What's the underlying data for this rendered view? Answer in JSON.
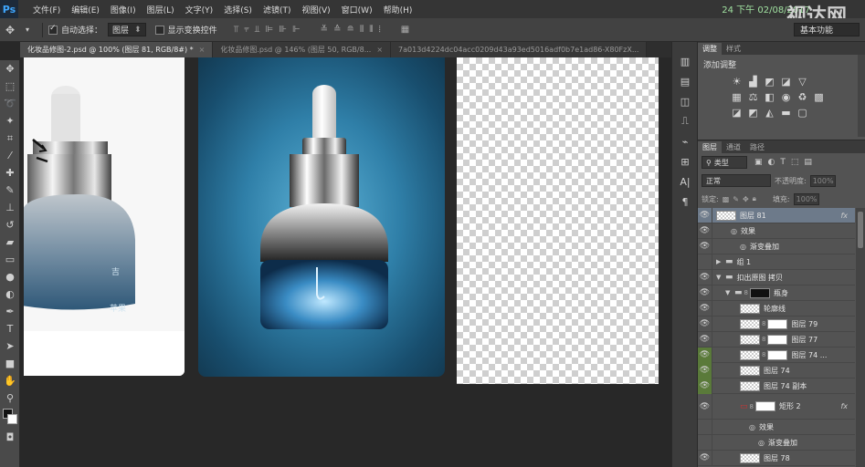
{
  "app": {
    "logo": "Ps",
    "menu": [
      "文件(F)",
      "编辑(E)",
      "图像(I)",
      "图层(L)",
      "文字(Y)",
      "选择(S)",
      "滤镜(T)",
      "视图(V)",
      "窗口(W)",
      "帮助(H)"
    ],
    "watermark_time": "24 下午 02/08/2017",
    "watermark_logo": "视达网"
  },
  "options": {
    "auto_select_label": "自动选择：",
    "auto_select_value": "图层",
    "show_transform_label": "显示变换控件",
    "workspace": "基本功能"
  },
  "tabs": [
    {
      "label": "化妆品修图-2.psd @ 100% (图层 81, RGB/8#) *",
      "active": true
    },
    {
      "label": "化妆品修图.psd @ 146% (图层 50, RGB/8...",
      "active": false
    },
    {
      "label": "7a013d4224dc04acc0209d43a93ed5016adf0b7e1ad86-X80FzX...",
      "active": false
    }
  ],
  "adjust_panel": {
    "tabs": [
      "调整",
      "样式"
    ],
    "title": "添加调整"
  },
  "layers_panel": {
    "tabs": [
      "图层",
      "通道",
      "路径"
    ],
    "filter_type": "类型",
    "blend_mode": "正常",
    "opacity_label": "不透明度:",
    "opacity_value": "100%",
    "lock_label": "锁定:",
    "fill_label": "填充:",
    "fill_value": "100%",
    "layers": [
      {
        "name": "图层 81",
        "kind": "layer",
        "visible": true,
        "selected": true,
        "fx": "fx",
        "indent": 0
      },
      {
        "name": "效果",
        "kind": "effect-header",
        "indent": 1
      },
      {
        "name": "渐变叠加",
        "kind": "effect",
        "indent": 2
      },
      {
        "name": "组 1",
        "kind": "group-closed",
        "visible": false,
        "indent": 0
      },
      {
        "name": "扣出原图 拷贝",
        "kind": "group-open",
        "visible": true,
        "indent": 0
      },
      {
        "name": "瓶身",
        "kind": "group-mask",
        "visible": true,
        "indent": 1
      },
      {
        "name": "轮廓线",
        "kind": "layer",
        "visible": true,
        "indent": 2
      },
      {
        "name": "图层 79",
        "kind": "layer-mask",
        "visible": true,
        "indent": 2
      },
      {
        "name": "图层 77",
        "kind": "layer-mask",
        "visible": true,
        "indent": 2
      },
      {
        "name": "图层 74 ...",
        "kind": "layer-mask-white",
        "visible": true,
        "green": true,
        "indent": 2
      },
      {
        "name": "图层 74",
        "kind": "layer",
        "visible": true,
        "green": true,
        "indent": 2
      },
      {
        "name": "图层 74 副本",
        "kind": "layer",
        "visible": true,
        "green": true,
        "indent": 2
      },
      {
        "name": "矩形 2",
        "kind": "shape",
        "visible": true,
        "fx": "fx",
        "indent": 2
      },
      {
        "name": "效果",
        "kind": "effect-header",
        "indent": 3
      },
      {
        "name": "渐变叠加",
        "kind": "effect",
        "indent": 4
      },
      {
        "name": "图层 78",
        "kind": "layer",
        "visible": true,
        "indent": 2
      }
    ]
  }
}
